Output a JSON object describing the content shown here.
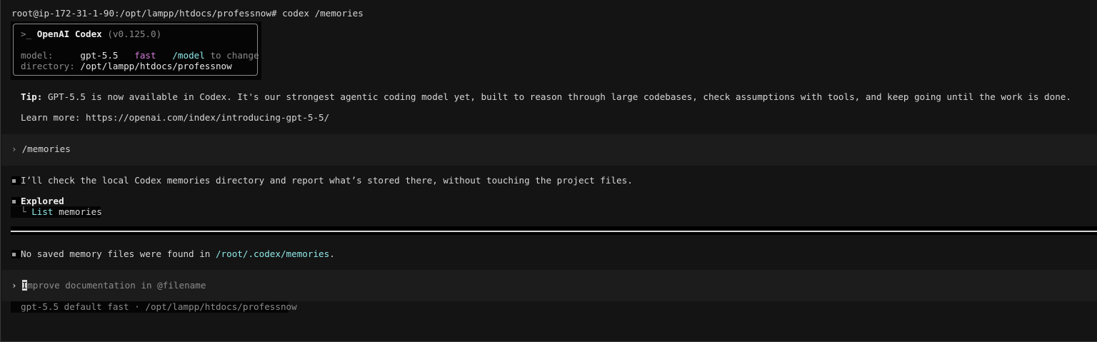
{
  "prompt_line": "root@ip-172-31-1-90:/opt/lampp/htdocs/professnow# codex /memories",
  "header": {
    "prompt_prefix": ">_ ",
    "app_name": "OpenAI Codex",
    "version": "(v0.125.0)",
    "model_label": "model:",
    "model_value": "gpt-5.5",
    "model_speed": "fast",
    "model_cmd": "/model",
    "model_hint": "to change",
    "dir_label": "directory:",
    "dir_value": "/opt/lampp/htdocs/professnow"
  },
  "tip": {
    "label": "Tip:",
    "text": "GPT-5.5 is now available in Codex. It's our strongest agentic coding model yet, built to reason through large codebases, check assumptions with tools, and keep going until the work is done.",
    "learn_more": "Learn more: https://openai.com/index/introducing-gpt-5-5/"
  },
  "user_command": "/memories",
  "assistant": {
    "message1": "I’ll check the local Codex memories directory and report what’s stored there, without touching the project files.",
    "explored_label": "Explored",
    "tree_glyph": "└",
    "action_verb": "List",
    "action_target": "memories",
    "message2_prefix": "No saved memory files were found in ",
    "message2_path": "/root/.codex/memories",
    "message2_suffix": "."
  },
  "input": {
    "cursor_char": "I",
    "placeholder_rest": "mprove documentation in @filename"
  },
  "status_bar": "gpt-5.5 default fast · /opt/lampp/htdocs/professnow",
  "colors": {
    "background": "#141414",
    "accent_cyan": "#8ee6e6",
    "accent_magenta": "#d17bd8",
    "band": "#1c1c1c"
  }
}
